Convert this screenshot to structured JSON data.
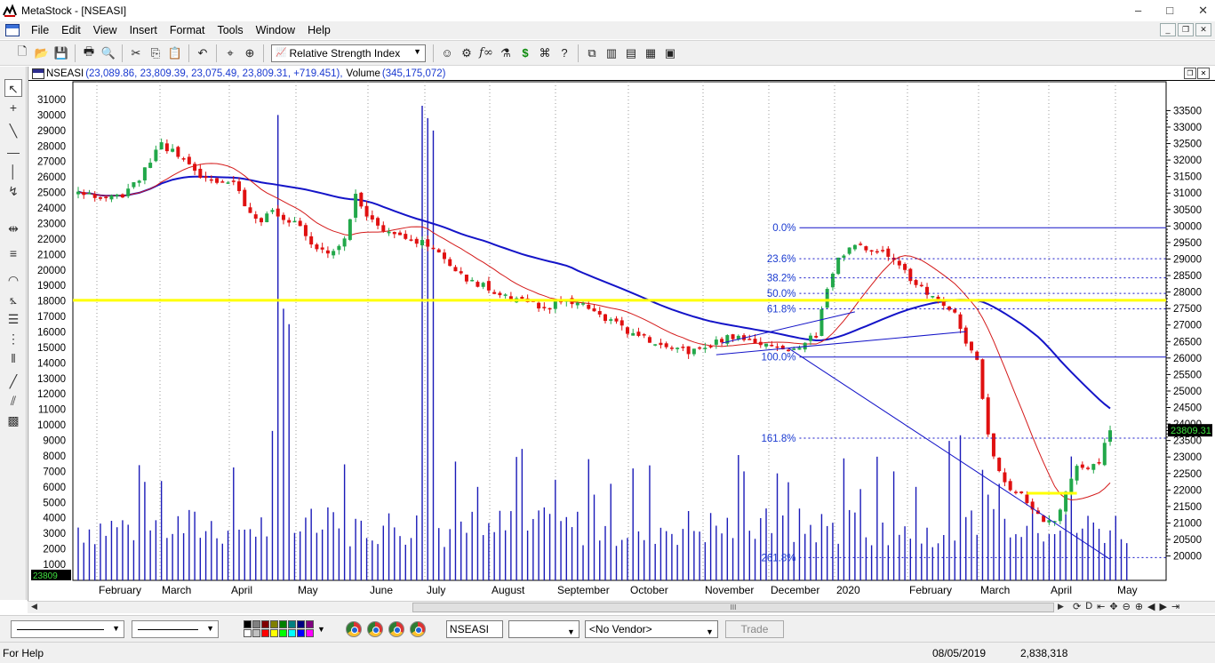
{
  "window": {
    "title": "MetaStock - [NSEASI]"
  },
  "menu": [
    "File",
    "Edit",
    "View",
    "Insert",
    "Format",
    "Tools",
    "Window",
    "Help"
  ],
  "toolbar": {
    "indicator_selected": "Relative Strength Index",
    "icons": [
      "new-icon",
      "open-icon",
      "save-icon",
      "print-icon",
      "print-preview-icon",
      "cut-icon",
      "copy-icon",
      "paste-icon",
      "undo-icon",
      "crosshair-icon",
      "zoom-icon",
      "expert-advisor-icon",
      "indicator-builder-icon",
      "formula-icon",
      "explorer-icon",
      "system-tester-icon",
      "binoculars-icon",
      "help-icon",
      "window-cascade-icon",
      "window-tile-vertical-icon",
      "window-tile-horizontal-icon",
      "window-grid-icon",
      "window-arrange-icon"
    ]
  },
  "chart_header": {
    "symbol": "NSEASI",
    "values": "(23,089.86, 23,809.39, 23,075.49, 23,809.31, +719.451),",
    "volume_label": "Volume",
    "volume_value": "(345,175,072)"
  },
  "chart_data": {
    "type": "candlestick",
    "symbol": "NSEASI",
    "last_close": 23809.31,
    "price_axis": {
      "min": 19800,
      "max": 33700,
      "step": 500
    },
    "volume_axis": {
      "min": 1000,
      "max": 31000,
      "step": 1000
    },
    "months": [
      "February",
      "March",
      "April",
      "May",
      "June",
      "July",
      "August",
      "September",
      "October",
      "November",
      "December",
      "2020",
      "February",
      "March",
      "April",
      "May"
    ],
    "price_path": [
      [
        0,
        31010
      ],
      [
        5,
        30810
      ],
      [
        8,
        30960
      ],
      [
        11,
        31410
      ],
      [
        13,
        32010
      ],
      [
        15,
        32510
      ],
      [
        18,
        32110
      ],
      [
        20,
        31810
      ],
      [
        22,
        31510
      ],
      [
        25,
        31300
      ],
      [
        28,
        31400
      ],
      [
        30,
        30610
      ],
      [
        33,
        30190
      ],
      [
        35,
        30410
      ],
      [
        38,
        30210
      ],
      [
        40,
        30000
      ],
      [
        42,
        29490
      ],
      [
        45,
        29210
      ],
      [
        48,
        29600
      ],
      [
        50,
        30890
      ],
      [
        52,
        30210
      ],
      [
        54,
        30010
      ],
      [
        56,
        29880
      ],
      [
        58,
        29810
      ],
      [
        60,
        29610
      ],
      [
        62,
        29490
      ],
      [
        64,
        29310
      ],
      [
        67,
        28900
      ],
      [
        70,
        28400
      ],
      [
        73,
        28190
      ],
      [
        76,
        27880
      ],
      [
        80,
        27690
      ],
      [
        84,
        27500
      ],
      [
        88,
        27720
      ],
      [
        91,
        27600
      ],
      [
        94,
        27280
      ],
      [
        98,
        26910
      ],
      [
        101,
        26700
      ],
      [
        104,
        26420
      ],
      [
        107,
        26300
      ],
      [
        110,
        26210
      ],
      [
        113,
        26300
      ],
      [
        116,
        26580
      ],
      [
        119,
        26680
      ],
      [
        122,
        26510
      ],
      [
        125,
        26400
      ],
      [
        128,
        26210
      ],
      [
        130,
        26370
      ],
      [
        133,
        26690
      ],
      [
        135,
        28090
      ],
      [
        137,
        29000
      ],
      [
        140,
        29420
      ],
      [
        143,
        29330
      ],
      [
        146,
        29110
      ],
      [
        149,
        28600
      ],
      [
        152,
        28100
      ],
      [
        155,
        27800
      ],
      [
        158,
        27290
      ],
      [
        160,
        26400
      ],
      [
        162,
        25900
      ],
      [
        164,
        23600
      ],
      [
        166,
        22600
      ],
      [
        168,
        22000
      ],
      [
        170,
        21900
      ],
      [
        172,
        21400
      ],
      [
        174,
        21100
      ],
      [
        176,
        21000
      ],
      [
        178,
        22000
      ],
      [
        180,
        22800
      ],
      [
        182,
        22600
      ],
      [
        184,
        22900
      ],
      [
        186,
        23810
      ]
    ],
    "moving_average_fast": "red",
    "moving_average_slow": "blue",
    "horizontal_support": 27750,
    "fibonacci": {
      "levels": [
        "0.0%",
        "23.6%",
        "38.2%",
        "50.0%",
        "61.8%",
        "100.0%",
        "161.8%",
        "261.8%"
      ],
      "prices": [
        29950,
        29010,
        28430,
        27960,
        27490,
        26030,
        23570,
        19950
      ]
    },
    "secondary_support": 21900
  },
  "scrollbar": {
    "thumb_label": "III"
  },
  "nav_buttons": [
    "refresh-icon",
    "D",
    "arrow-left-end-icon",
    "cross-move-icon",
    "zoom-out-icon",
    "zoom-in-icon",
    "arrow-left-icon",
    "arrow-right-icon",
    "arrow-right-end-icon"
  ],
  "bottom_bar": {
    "symbol": "NSEASI",
    "vendor": "<No Vendor>",
    "trade_label": "Trade",
    "palette_colors": [
      "#000000",
      "#808080",
      "#800000",
      "#808000",
      "#008000",
      "#008080",
      "#000080",
      "#800080",
      "#ffffff",
      "#c0c0c0",
      "#ff0000",
      "#ffff00",
      "#00ff00",
      "#00ffff",
      "#0000ff",
      "#ff00ff"
    ]
  },
  "status": {
    "help": "For Help",
    "date": "08/05/2019",
    "volume": "2,838,318"
  },
  "colors": {
    "up_candle": "#22a84a",
    "down_candle": "#e01010",
    "ma_fast": "#d41a1a",
    "ma_slow": "#1414c8",
    "support_line": "#ffff00",
    "volume_bar": "#1a1ab8",
    "fib_text": "#1a3ad0"
  }
}
